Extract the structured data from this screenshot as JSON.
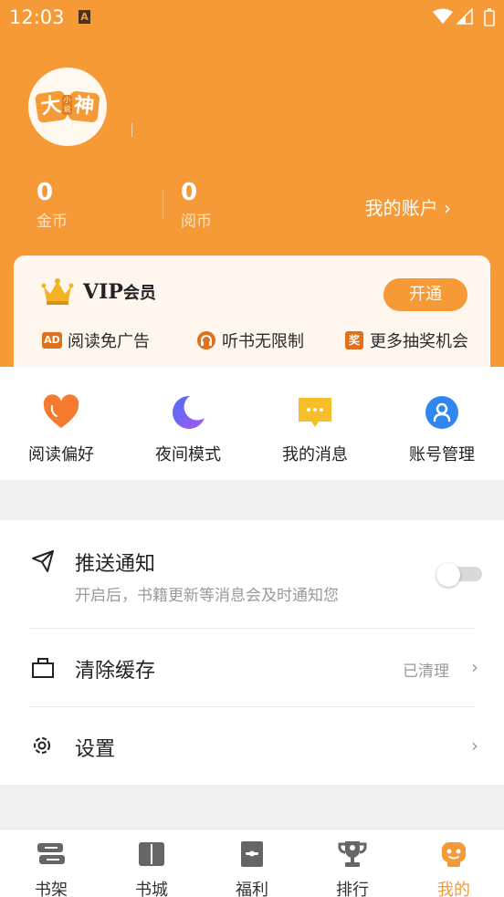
{
  "status_bar": {
    "time": "12:03",
    "notification_letter": "A"
  },
  "profile": {
    "avatar_chars": [
      "大",
      "小说",
      "神"
    ]
  },
  "stats": [
    {
      "value": "0",
      "label": "金币"
    },
    {
      "value": "0",
      "label": "阅币"
    }
  ],
  "account_link": "我的账户 ›",
  "vip": {
    "title": "VIP",
    "title_suffix": "会员",
    "button": "开通",
    "perks": [
      {
        "icon_text": "AD",
        "label": "阅读免广告"
      },
      {
        "label": "听书无限制"
      },
      {
        "icon_text": "奖",
        "label": "更多抽奖机会"
      }
    ]
  },
  "quick_actions": [
    {
      "label": "阅读偏好"
    },
    {
      "label": "夜间模式"
    },
    {
      "label": "我的消息"
    },
    {
      "label": "账号管理"
    }
  ],
  "settings": [
    {
      "title": "推送通知",
      "subtitle": "开启后，书籍更新等消息会及时通知您",
      "toggle_on": false
    },
    {
      "title": "清除缓存",
      "value": "已清理"
    },
    {
      "title": "设置"
    }
  ],
  "tabs": [
    {
      "label": "书架",
      "active": false
    },
    {
      "label": "书城",
      "active": false
    },
    {
      "label": "福利",
      "active": false
    },
    {
      "label": "排行",
      "active": false
    },
    {
      "label": "我的",
      "active": true
    }
  ],
  "colors": {
    "accent": "#f59a36",
    "vip_bg": "#fff6ed"
  }
}
